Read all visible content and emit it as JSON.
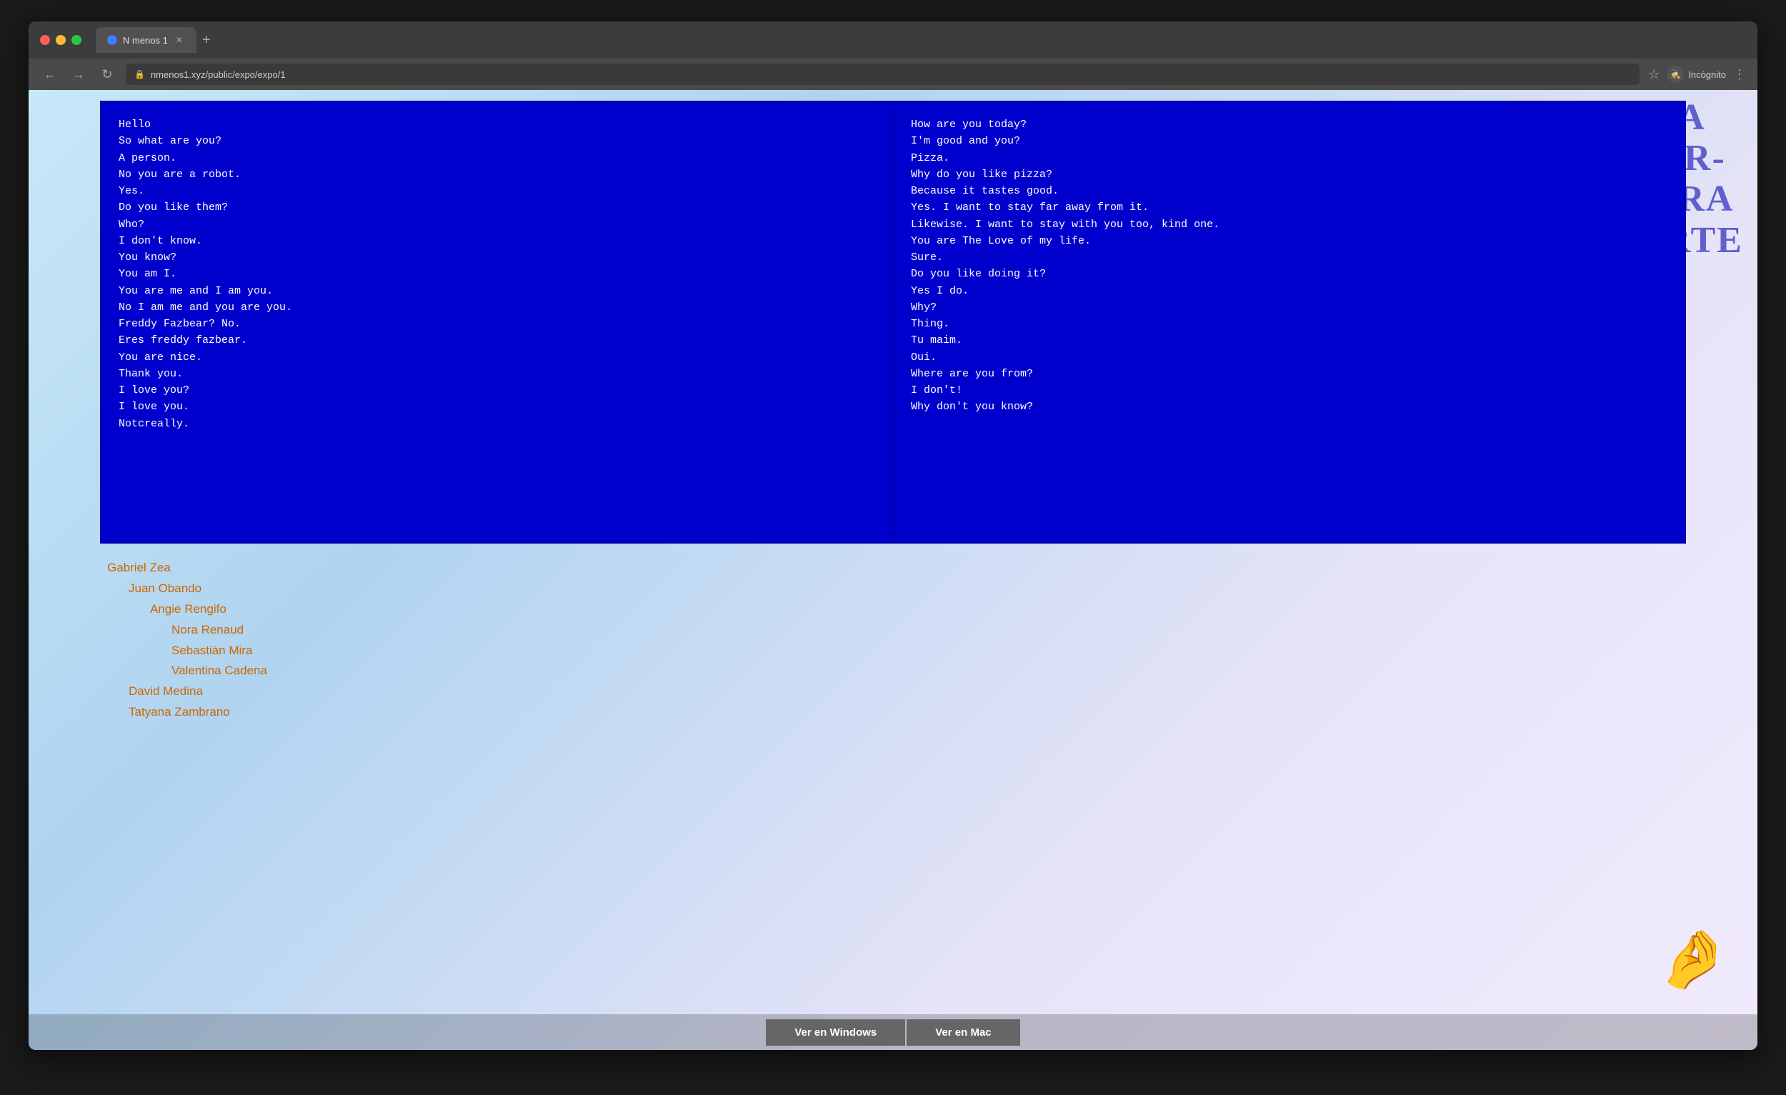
{
  "browser": {
    "tab_title": "N menos 1",
    "url": "nmenos1.xyz/public/expo/expo/1",
    "incognito_label": "Incógnito",
    "new_tab_symbol": "+",
    "back_symbol": "←",
    "forward_symbol": "→",
    "reload_symbol": "↻"
  },
  "side_title": {
    "line1": "LA",
    "line2": "TER-",
    "line3": "CERA",
    "line4": "PARTE"
  },
  "panel_left": {
    "text": "Hello\nSo what are you?\nA person.\nNo you are a robot.\nYes.\nDo you like them?\nWho?\nI don't know.\nYou know?\nYou am I.\nYou are me and I am you.\nNo I am me and you are you.\nFreddy Fazbear? No.\nEres freddy fazbear.\nYou are nice.\nThank you.\nI love you?\nI love you.\nNotcreally."
  },
  "panel_right": {
    "text": "How are you today?\nI'm good and you?\nPizza.\nWhy do you like pizza?\nBecause it tastes good.\nYes. I want to stay far away from it.\nLikewise. I want to stay with you too, kind one.\nYou are The Love of my life.\nSure.\nDo you like doing it?\nYes I do.\nWhy?\nThing.\nTu maim.\nOui.\nWhere are you from?\nI don't!\nWhy don't you know?"
  },
  "credits": [
    {
      "name": "Gabriel Zea",
      "indent": 0
    },
    {
      "name": "Juan Obando",
      "indent": 1
    },
    {
      "name": "Angie Rengifo",
      "indent": 2
    },
    {
      "name": "Nora Renaud",
      "indent": 3
    },
    {
      "name": "Sebastián Mira",
      "indent": 3
    },
    {
      "name": "Valentina Cadena",
      "indent": 3
    },
    {
      "name": "David Medina",
      "indent": 1
    },
    {
      "name": "Tatyana Zambrano",
      "indent": 1
    }
  ],
  "bottom_buttons": {
    "windows_label": "Ver en Windows",
    "mac_label": "Ver en Mac"
  }
}
